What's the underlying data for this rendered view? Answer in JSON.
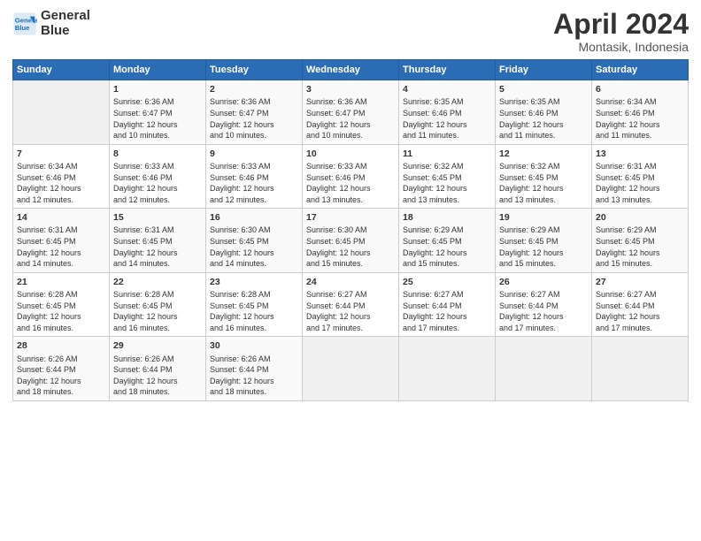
{
  "header": {
    "logo_line1": "General",
    "logo_line2": "Blue",
    "title": "April 2024",
    "subtitle": "Montasik, Indonesia"
  },
  "weekdays": [
    "Sunday",
    "Monday",
    "Tuesday",
    "Wednesday",
    "Thursday",
    "Friday",
    "Saturday"
  ],
  "weeks": [
    [
      {
        "day": "",
        "data": ""
      },
      {
        "day": "1",
        "data": "Sunrise: 6:36 AM\nSunset: 6:47 PM\nDaylight: 12 hours\nand 10 minutes."
      },
      {
        "day": "2",
        "data": "Sunrise: 6:36 AM\nSunset: 6:47 PM\nDaylight: 12 hours\nand 10 minutes."
      },
      {
        "day": "3",
        "data": "Sunrise: 6:36 AM\nSunset: 6:47 PM\nDaylight: 12 hours\nand 10 minutes."
      },
      {
        "day": "4",
        "data": "Sunrise: 6:35 AM\nSunset: 6:46 PM\nDaylight: 12 hours\nand 11 minutes."
      },
      {
        "day": "5",
        "data": "Sunrise: 6:35 AM\nSunset: 6:46 PM\nDaylight: 12 hours\nand 11 minutes."
      },
      {
        "day": "6",
        "data": "Sunrise: 6:34 AM\nSunset: 6:46 PM\nDaylight: 12 hours\nand 11 minutes."
      }
    ],
    [
      {
        "day": "7",
        "data": "Sunrise: 6:34 AM\nSunset: 6:46 PM\nDaylight: 12 hours\nand 12 minutes."
      },
      {
        "day": "8",
        "data": "Sunrise: 6:33 AM\nSunset: 6:46 PM\nDaylight: 12 hours\nand 12 minutes."
      },
      {
        "day": "9",
        "data": "Sunrise: 6:33 AM\nSunset: 6:46 PM\nDaylight: 12 hours\nand 12 minutes."
      },
      {
        "day": "10",
        "data": "Sunrise: 6:33 AM\nSunset: 6:46 PM\nDaylight: 12 hours\nand 13 minutes."
      },
      {
        "day": "11",
        "data": "Sunrise: 6:32 AM\nSunset: 6:45 PM\nDaylight: 12 hours\nand 13 minutes."
      },
      {
        "day": "12",
        "data": "Sunrise: 6:32 AM\nSunset: 6:45 PM\nDaylight: 12 hours\nand 13 minutes."
      },
      {
        "day": "13",
        "data": "Sunrise: 6:31 AM\nSunset: 6:45 PM\nDaylight: 12 hours\nand 13 minutes."
      }
    ],
    [
      {
        "day": "14",
        "data": "Sunrise: 6:31 AM\nSunset: 6:45 PM\nDaylight: 12 hours\nand 14 minutes."
      },
      {
        "day": "15",
        "data": "Sunrise: 6:31 AM\nSunset: 6:45 PM\nDaylight: 12 hours\nand 14 minutes."
      },
      {
        "day": "16",
        "data": "Sunrise: 6:30 AM\nSunset: 6:45 PM\nDaylight: 12 hours\nand 14 minutes."
      },
      {
        "day": "17",
        "data": "Sunrise: 6:30 AM\nSunset: 6:45 PM\nDaylight: 12 hours\nand 15 minutes."
      },
      {
        "day": "18",
        "data": "Sunrise: 6:29 AM\nSunset: 6:45 PM\nDaylight: 12 hours\nand 15 minutes."
      },
      {
        "day": "19",
        "data": "Sunrise: 6:29 AM\nSunset: 6:45 PM\nDaylight: 12 hours\nand 15 minutes."
      },
      {
        "day": "20",
        "data": "Sunrise: 6:29 AM\nSunset: 6:45 PM\nDaylight: 12 hours\nand 15 minutes."
      }
    ],
    [
      {
        "day": "21",
        "data": "Sunrise: 6:28 AM\nSunset: 6:45 PM\nDaylight: 12 hours\nand 16 minutes."
      },
      {
        "day": "22",
        "data": "Sunrise: 6:28 AM\nSunset: 6:45 PM\nDaylight: 12 hours\nand 16 minutes."
      },
      {
        "day": "23",
        "data": "Sunrise: 6:28 AM\nSunset: 6:45 PM\nDaylight: 12 hours\nand 16 minutes."
      },
      {
        "day": "24",
        "data": "Sunrise: 6:27 AM\nSunset: 6:44 PM\nDaylight: 12 hours\nand 17 minutes."
      },
      {
        "day": "25",
        "data": "Sunrise: 6:27 AM\nSunset: 6:44 PM\nDaylight: 12 hours\nand 17 minutes."
      },
      {
        "day": "26",
        "data": "Sunrise: 6:27 AM\nSunset: 6:44 PM\nDaylight: 12 hours\nand 17 minutes."
      },
      {
        "day": "27",
        "data": "Sunrise: 6:27 AM\nSunset: 6:44 PM\nDaylight: 12 hours\nand 17 minutes."
      }
    ],
    [
      {
        "day": "28",
        "data": "Sunrise: 6:26 AM\nSunset: 6:44 PM\nDaylight: 12 hours\nand 18 minutes."
      },
      {
        "day": "29",
        "data": "Sunrise: 6:26 AM\nSunset: 6:44 PM\nDaylight: 12 hours\nand 18 minutes."
      },
      {
        "day": "30",
        "data": "Sunrise: 6:26 AM\nSunset: 6:44 PM\nDaylight: 12 hours\nand 18 minutes."
      },
      {
        "day": "",
        "data": ""
      },
      {
        "day": "",
        "data": ""
      },
      {
        "day": "",
        "data": ""
      },
      {
        "day": "",
        "data": ""
      }
    ]
  ]
}
